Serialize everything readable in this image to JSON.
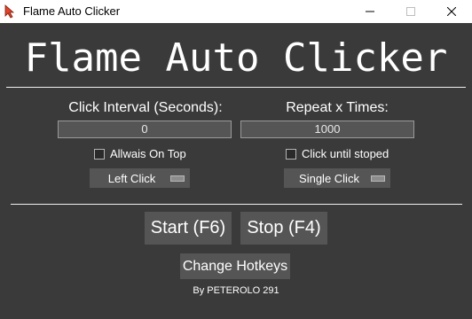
{
  "window": {
    "title": "Flame Auto Clicker",
    "icon": "flame-cursor-icon",
    "controls": [
      "minimize-icon",
      "maximize-icon",
      "close-icon"
    ]
  },
  "header": {
    "title": "Flame Auto Clicker"
  },
  "interval": {
    "label": "Click Interval (Seconds):",
    "value": "0"
  },
  "repeat": {
    "label": "Repeat x Times:",
    "value": "1000"
  },
  "options": {
    "always_on_top": {
      "label": "Allwais On Top",
      "checked": false
    },
    "click_until_stopped": {
      "label": "Click until stoped",
      "checked": false
    }
  },
  "mouse_button": {
    "selected": "Left Click"
  },
  "click_type": {
    "selected": "Single Click"
  },
  "buttons": {
    "start": "Start (F6)",
    "stop": "Stop (F4)",
    "hotkeys": "Change Hotkeys"
  },
  "footer": {
    "credit": "By PETEROLO 291"
  },
  "colors": {
    "background": "#3a3a3a",
    "control": "#555555",
    "text": "#ffffff",
    "accent": "#e0442a"
  }
}
